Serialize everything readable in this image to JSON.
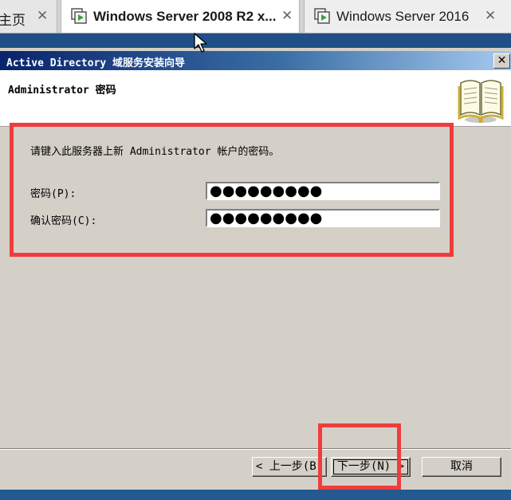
{
  "tabs": [
    {
      "label": "主页",
      "close": "✕"
    },
    {
      "label": "Windows Server 2008 R2 x...",
      "close": "✕"
    },
    {
      "label": "Windows Server 2016",
      "close": "✕"
    }
  ],
  "dialog": {
    "title": "Active Directory 域服务安装向导",
    "close_glyph": "✕",
    "header_title": "Administrator 密码",
    "instruction": "请键入此服务器上新 Administrator 帐户的密码。",
    "password_label": "密码(P):",
    "password_value": "●●●●●●●●●",
    "confirm_label": "确认密码(C):",
    "confirm_value": "●●●●●●●●●",
    "back_button": "< 上一步(B)",
    "next_button": "下一步(N) >",
    "cancel_button": "取消"
  },
  "colors": {
    "annotation": "#f03c3c",
    "dialog_bg": "#d4d0c8",
    "titlebar_start": "#08246b",
    "titlebar_end": "#a6caf0"
  },
  "icons": [
    "vm-play-icon",
    "book-icon",
    "close-icon",
    "mouse-cursor-icon"
  ]
}
